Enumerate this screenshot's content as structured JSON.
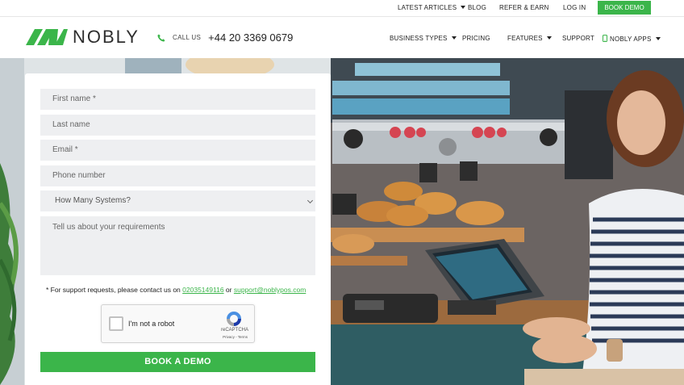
{
  "topbar": {
    "latest_articles": "LATEST ARTICLES",
    "blog": "BLOG",
    "refer": "REFER & EARN",
    "login": "LOG IN",
    "book_demo": "BOOK DEMO"
  },
  "header": {
    "logo_text": "NOBLY",
    "call_label": "CALL US",
    "phone": "+44 20 3369 0679",
    "nav": {
      "business_types": "BUSINESS TYPES",
      "pricing": "PRICING",
      "features": "FEATURES",
      "support": "SUPPORT",
      "apps": "NOBLY APPS"
    }
  },
  "form": {
    "first_name_placeholder": "First name *",
    "last_name_placeholder": "Last name",
    "email_placeholder": "Email *",
    "phone_placeholder": "Phone number",
    "systems_select": "How Many Systems?",
    "requirements_placeholder": "Tell us about your requirements",
    "support_note_prefix": "* For support requests, please contact us on",
    "support_phone": "02035149116",
    "support_or": "or",
    "support_email": "support@noblypos.com",
    "captcha_label": "I'm not a robot",
    "captcha_brand": "reCAPTCHA",
    "captcha_terms": "Privacy - Terms",
    "submit": "BOOK A DEMO"
  },
  "colors": {
    "accent": "#3bb54a",
    "field_bg": "#eeeff1"
  },
  "icons": {
    "phone": "phone-icon",
    "mobile": "mobile-icon",
    "recaptcha": "recaptcha-icon"
  }
}
